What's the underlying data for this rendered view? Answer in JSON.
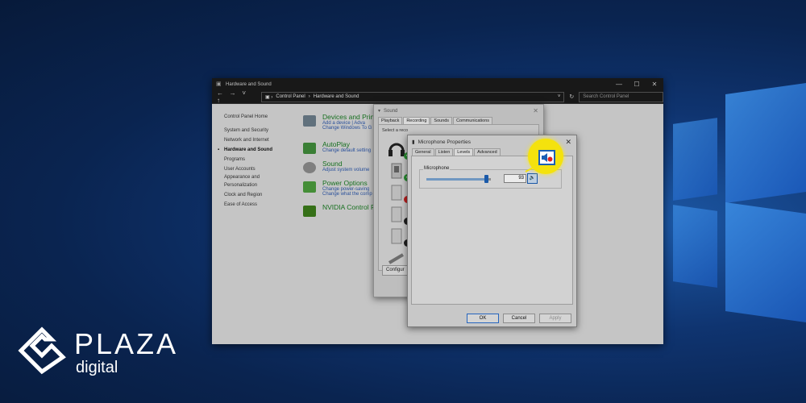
{
  "control_panel": {
    "title": "Hardware and Sound",
    "breadcrumb": [
      "Control Panel",
      "Hardware and Sound"
    ],
    "search_placeholder": "Search Control Panel",
    "sidebar": [
      {
        "label": "Control Panel Home"
      },
      {
        "label": "System and Security"
      },
      {
        "label": "Network and Internet"
      },
      {
        "label": "Hardware and Sound",
        "current": true
      },
      {
        "label": "Programs"
      },
      {
        "label": "User Accounts"
      },
      {
        "label": "Appearance and"
      },
      {
        "label": "Personalization"
      },
      {
        "label": "Clock and Region"
      },
      {
        "label": "Ease of Access"
      }
    ],
    "categories": [
      {
        "title": "Devices and Printe",
        "links": [
          "Add a device  |  Adva",
          "Change Windows To G"
        ],
        "icon": "printer-icon",
        "color": "#6a7b88"
      },
      {
        "title": "AutoPlay",
        "links": [
          "Change default setting"
        ],
        "icon": "autoplay-icon",
        "color": "#3f8a3a"
      },
      {
        "title": "Sound",
        "links": [
          "Adjust system volume"
        ],
        "icon": "speaker-icon",
        "color": "#8a8a8a"
      },
      {
        "title": "Power Options",
        "links": [
          "Change power-saving",
          "Change what the comp"
        ],
        "icon": "battery-icon",
        "color": "#4a9b3c"
      },
      {
        "title": "NVIDIA Control Pa",
        "links": [],
        "icon": "nvidia-icon",
        "color": "#3a7a1a"
      }
    ]
  },
  "sound_dialog": {
    "title": "Sound",
    "tabs": [
      "Playback",
      "Recording",
      "Sounds",
      "Communications"
    ],
    "active_tab": "Recording",
    "select_text": "Select a reco",
    "configure_label": "Configur",
    "devices": [
      {
        "icon": "headset-icon",
        "status": "green"
      },
      {
        "icon": "microphone-icon",
        "status": "green"
      },
      {
        "icon": "microphone-icon",
        "status": "red"
      },
      {
        "icon": "microphone-icon",
        "status": "black"
      },
      {
        "icon": "microphone-icon",
        "status": "black"
      },
      {
        "icon": "line-in-icon",
        "status": "none"
      }
    ]
  },
  "mic_properties": {
    "title": "Microphone Properties",
    "tabs": [
      "General",
      "Listen",
      "Levels",
      "Advanced"
    ],
    "active_tab": "Levels",
    "group_label": "Microphone",
    "level": 93,
    "level_text": "93",
    "buttons": {
      "ok": "OK",
      "cancel": "Cancel",
      "apply": "Apply"
    },
    "highlight_color": "#f4e20d"
  },
  "logo": {
    "word": "PLAZA",
    "sub": "digital"
  }
}
